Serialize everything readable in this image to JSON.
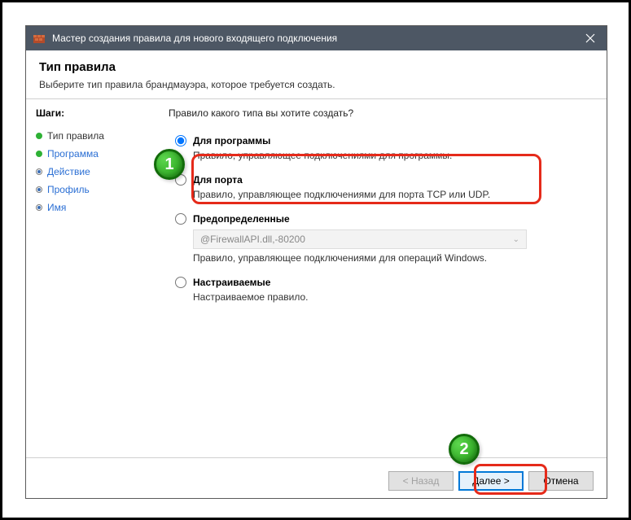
{
  "titlebar": {
    "text": "Мастер создания правила для нового входящего подключения"
  },
  "header": {
    "title": "Тип правила",
    "subtitle": "Выберите тип правила брандмауэра, которое требуется создать."
  },
  "steps": {
    "title": "Шаги:",
    "items": [
      {
        "label": "Тип правила"
      },
      {
        "label": "Программа"
      },
      {
        "label": "Действие"
      },
      {
        "label": "Профиль"
      },
      {
        "label": "Имя"
      }
    ]
  },
  "main": {
    "prompt": "Правило какого типа вы хотите создать?",
    "options": {
      "program": {
        "label": "Для программы",
        "desc": "Правило, управляющее подключениями для программы."
      },
      "port": {
        "label": "Для порта",
        "desc": "Правило, управляющее подключениями для порта TCP или UDP."
      },
      "predefined": {
        "label": "Предопределенные",
        "desc": "Правило, управляющее подключениями для операций Windows.",
        "dropdown": "@FirewallAPI.dll,-80200"
      },
      "custom": {
        "label": "Настраиваемые",
        "desc": "Настраиваемое правило."
      }
    }
  },
  "footer": {
    "back": "< Назад",
    "next": "Далее >",
    "cancel": "Отмена"
  },
  "badges": {
    "one": "1",
    "two": "2"
  }
}
